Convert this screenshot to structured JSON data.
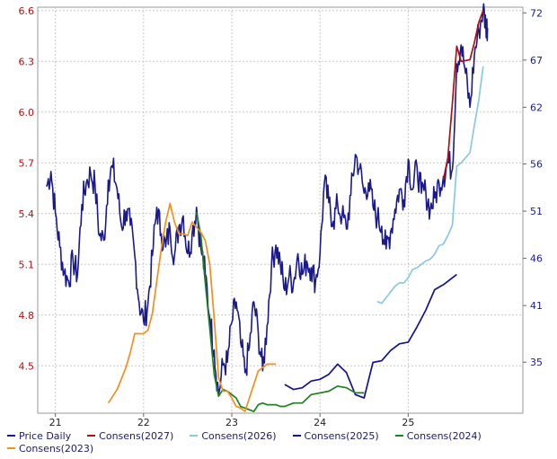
{
  "chart_data": {
    "type": "line",
    "title": "",
    "xlabel": "",
    "ylabel": "",
    "x_range": [
      2020.8,
      2026.3
    ],
    "x_ticks": [
      {
        "label": "21",
        "value": 2021
      },
      {
        "label": "22",
        "value": 2022
      },
      {
        "label": "23",
        "value": 2023
      },
      {
        "label": "24",
        "value": 2024
      },
      {
        "label": "25",
        "value": 2025
      }
    ],
    "y_left_range": [
      4.22,
      6.62
    ],
    "y_left_ticks": [
      "6.6",
      "6.3",
      "6.0",
      "5.7",
      "5.4",
      "5.1",
      "4.8",
      "4.5"
    ],
    "y_right_range": [
      29.6,
      72.6
    ],
    "y_right_ticks": [
      "72",
      "67",
      "62",
      "56",
      "51",
      "46",
      "41",
      "35"
    ],
    "grid": true,
    "legend_position": "bottom",
    "series": [
      {
        "name": "Price Daily",
        "axis": "right",
        "color": "#1a1a8c",
        "points": [
          [
            2020.9,
            53.6
          ],
          [
            2020.95,
            55.2
          ],
          [
            2021.0,
            50.8
          ],
          [
            2021.05,
            47.2
          ],
          [
            2021.1,
            44.5
          ],
          [
            2021.15,
            43.6
          ],
          [
            2021.2,
            45.8
          ],
          [
            2021.25,
            44.2
          ],
          [
            2021.3,
            51.7
          ],
          [
            2021.35,
            54.0
          ],
          [
            2021.4,
            55.0
          ],
          [
            2021.45,
            53.7
          ],
          [
            2021.5,
            48.4
          ],
          [
            2021.55,
            47.9
          ],
          [
            2021.6,
            54.3
          ],
          [
            2021.65,
            55.6
          ],
          [
            2021.7,
            53.3
          ],
          [
            2021.75,
            49.4
          ],
          [
            2021.8,
            51.0
          ],
          [
            2021.85,
            49.5
          ],
          [
            2021.9,
            46.3
          ],
          [
            2021.95,
            41.3
          ],
          [
            2022.0,
            39.3
          ],
          [
            2022.05,
            41.2
          ],
          [
            2022.1,
            46.3
          ],
          [
            2022.15,
            51.4
          ],
          [
            2022.2,
            48.6
          ],
          [
            2022.25,
            47.2
          ],
          [
            2022.3,
            49.1
          ],
          [
            2022.35,
            46.3
          ],
          [
            2022.4,
            49.4
          ],
          [
            2022.45,
            50.5
          ],
          [
            2022.5,
            46.5
          ],
          [
            2022.55,
            48.5
          ],
          [
            2022.6,
            51.4
          ],
          [
            2022.65,
            47.1
          ],
          [
            2022.7,
            44.3
          ],
          [
            2022.75,
            39.7
          ],
          [
            2022.8,
            36.3
          ],
          [
            2022.85,
            31.6
          ],
          [
            2022.9,
            34.7
          ],
          [
            2022.95,
            35.0
          ],
          [
            2023.0,
            39.2
          ],
          [
            2023.05,
            41.4
          ],
          [
            2023.1,
            37.1
          ],
          [
            2023.15,
            33.9
          ],
          [
            2023.2,
            36.6
          ],
          [
            2023.25,
            41.4
          ],
          [
            2023.3,
            38.1
          ],
          [
            2023.35,
            34.1
          ],
          [
            2023.4,
            38.9
          ],
          [
            2023.45,
            45.3
          ],
          [
            2023.5,
            47.4
          ],
          [
            2023.55,
            45.5
          ],
          [
            2023.6,
            42.6
          ],
          [
            2023.65,
            44.1
          ],
          [
            2023.7,
            43.4
          ],
          [
            2023.75,
            46.5
          ],
          [
            2023.8,
            44.3
          ],
          [
            2023.85,
            45.7
          ],
          [
            2023.9,
            45.0
          ],
          [
            2023.95,
            43.6
          ],
          [
            2024.0,
            46.5
          ],
          [
            2024.05,
            54.0
          ],
          [
            2024.1,
            51.9
          ],
          [
            2024.15,
            49.9
          ],
          [
            2024.2,
            51.7
          ],
          [
            2024.25,
            50.5
          ],
          [
            2024.3,
            49.1
          ],
          [
            2024.35,
            52.7
          ],
          [
            2024.4,
            57.0
          ],
          [
            2024.45,
            55.5
          ],
          [
            2024.5,
            52.9
          ],
          [
            2024.55,
            54.0
          ],
          [
            2024.6,
            51.5
          ],
          [
            2024.65,
            50.3
          ],
          [
            2024.7,
            49.4
          ],
          [
            2024.75,
            47.0
          ],
          [
            2024.8,
            48.8
          ],
          [
            2024.85,
            51.2
          ],
          [
            2024.9,
            53.3
          ],
          [
            2024.95,
            52.2
          ],
          [
            2025.0,
            56.5
          ],
          [
            2025.05,
            53.3
          ],
          [
            2025.1,
            55.7
          ],
          [
            2025.15,
            52.9
          ],
          [
            2025.2,
            53.0
          ],
          [
            2025.25,
            51.2
          ],
          [
            2025.3,
            52.4
          ],
          [
            2025.35,
            54.0
          ],
          [
            2025.4,
            54.7
          ],
          [
            2025.45,
            56.2
          ],
          [
            2025.5,
            55.4
          ],
          [
            2025.55,
            66.6
          ],
          [
            2025.6,
            68.6
          ],
          [
            2025.65,
            65.6
          ],
          [
            2025.7,
            62.0
          ],
          [
            2025.75,
            67.5
          ],
          [
            2025.8,
            70.1
          ],
          [
            2025.85,
            72.4
          ],
          [
            2025.88,
            70.7
          ],
          [
            2025.9,
            70.4
          ]
        ]
      },
      {
        "name": "Consens(2027)",
        "axis": "left",
        "color": "#b01010",
        "points": [
          [
            2025.4,
            5.6
          ],
          [
            2025.45,
            5.73
          ],
          [
            2025.5,
            6.05
          ],
          [
            2025.55,
            6.39
          ],
          [
            2025.6,
            6.3
          ],
          [
            2025.7,
            6.31
          ],
          [
            2025.75,
            6.41
          ],
          [
            2025.8,
            6.53
          ],
          [
            2025.85,
            6.6
          ]
        ]
      },
      {
        "name": "Consens(2026)",
        "axis": "left",
        "color": "#8cc8e0",
        "points": [
          [
            2024.65,
            4.88
          ],
          [
            2024.7,
            4.87
          ],
          [
            2024.85,
            4.97
          ],
          [
            2024.9,
            4.99
          ],
          [
            2024.95,
            4.99
          ],
          [
            2025.0,
            5.02
          ],
          [
            2025.05,
            5.07
          ],
          [
            2025.1,
            5.08
          ],
          [
            2025.15,
            5.1
          ],
          [
            2025.2,
            5.12
          ],
          [
            2025.25,
            5.13
          ],
          [
            2025.3,
            5.16
          ],
          [
            2025.35,
            5.21
          ],
          [
            2025.4,
            5.22
          ],
          [
            2025.45,
            5.27
          ],
          [
            2025.5,
            5.33
          ],
          [
            2025.55,
            5.68
          ],
          [
            2025.6,
            5.7
          ],
          [
            2025.65,
            5.73
          ],
          [
            2025.7,
            5.76
          ],
          [
            2025.75,
            5.92
          ],
          [
            2025.8,
            6.07
          ],
          [
            2025.85,
            6.27
          ]
        ]
      },
      {
        "name": "Consens(2025)",
        "axis": "left",
        "color": "#14148a",
        "points": [
          [
            2023.6,
            4.39
          ],
          [
            2023.7,
            4.36
          ],
          [
            2023.8,
            4.37
          ],
          [
            2023.9,
            4.41
          ],
          [
            2024.0,
            4.42
          ],
          [
            2024.1,
            4.45
          ],
          [
            2024.2,
            4.51
          ],
          [
            2024.3,
            4.46
          ],
          [
            2024.4,
            4.33
          ],
          [
            2024.5,
            4.31
          ],
          [
            2024.6,
            4.52
          ],
          [
            2024.7,
            4.53
          ],
          [
            2024.8,
            4.59
          ],
          [
            2024.9,
            4.63
          ],
          [
            2025.0,
            4.64
          ],
          [
            2025.1,
            4.73
          ],
          [
            2025.2,
            4.83
          ],
          [
            2025.3,
            4.95
          ],
          [
            2025.4,
            4.98
          ],
          [
            2025.5,
            5.02
          ],
          [
            2025.55,
            5.04
          ]
        ]
      },
      {
        "name": "Consens(2024)",
        "axis": "left",
        "color": "#208020",
        "points": [
          [
            2022.6,
            5.41
          ],
          [
            2022.65,
            5.27
          ],
          [
            2022.7,
            4.99
          ],
          [
            2022.75,
            4.72
          ],
          [
            2022.8,
            4.45
          ],
          [
            2022.85,
            4.32
          ],
          [
            2022.9,
            4.36
          ],
          [
            2022.95,
            4.35
          ],
          [
            2023.0,
            4.33
          ],
          [
            2023.05,
            4.31
          ],
          [
            2023.1,
            4.26
          ],
          [
            2023.15,
            4.25
          ],
          [
            2023.2,
            4.24
          ],
          [
            2023.25,
            4.23
          ],
          [
            2023.3,
            4.27
          ],
          [
            2023.35,
            4.28
          ],
          [
            2023.4,
            4.27
          ],
          [
            2023.45,
            4.27
          ],
          [
            2023.5,
            4.27
          ],
          [
            2023.55,
            4.26
          ],
          [
            2023.6,
            4.26
          ],
          [
            2023.7,
            4.28
          ],
          [
            2023.8,
            4.28
          ],
          [
            2023.9,
            4.33
          ],
          [
            2024.0,
            4.34
          ],
          [
            2024.1,
            4.35
          ],
          [
            2024.2,
            4.38
          ],
          [
            2024.3,
            4.37
          ],
          [
            2024.4,
            4.34
          ],
          [
            2024.5,
            4.34
          ]
        ]
      },
      {
        "name": "Consens(2023)",
        "axis": "left",
        "color": "#f0901e",
        "points": [
          [
            2021.6,
            4.28
          ],
          [
            2021.7,
            4.36
          ],
          [
            2021.8,
            4.49
          ],
          [
            2021.85,
            4.58
          ],
          [
            2021.9,
            4.69
          ],
          [
            2022.0,
            4.69
          ],
          [
            2022.05,
            4.71
          ],
          [
            2022.1,
            4.81
          ],
          [
            2022.15,
            5.0
          ],
          [
            2022.2,
            5.19
          ],
          [
            2022.25,
            5.35
          ],
          [
            2022.3,
            5.46
          ],
          [
            2022.35,
            5.35
          ],
          [
            2022.4,
            5.28
          ],
          [
            2022.45,
            5.28
          ],
          [
            2022.5,
            5.27
          ],
          [
            2022.55,
            5.35
          ],
          [
            2022.6,
            5.32
          ],
          [
            2022.65,
            5.29
          ],
          [
            2022.7,
            5.24
          ],
          [
            2022.75,
            5.1
          ],
          [
            2022.8,
            4.78
          ],
          [
            2022.85,
            4.43
          ],
          [
            2022.9,
            4.35
          ],
          [
            2022.95,
            4.35
          ],
          [
            2023.0,
            4.31
          ],
          [
            2023.05,
            4.26
          ],
          [
            2023.1,
            4.25
          ],
          [
            2023.15,
            4.23
          ],
          [
            2023.2,
            4.31
          ],
          [
            2023.25,
            4.39
          ],
          [
            2023.3,
            4.47
          ],
          [
            2023.4,
            4.51
          ],
          [
            2023.5,
            4.51
          ]
        ]
      }
    ],
    "legend": [
      [
        "Price Daily",
        "Consens(2027)",
        "Consens(2026)",
        "Consens(2025)",
        "Consens(2024)"
      ],
      [
        "Consens(2023)"
      ]
    ]
  }
}
